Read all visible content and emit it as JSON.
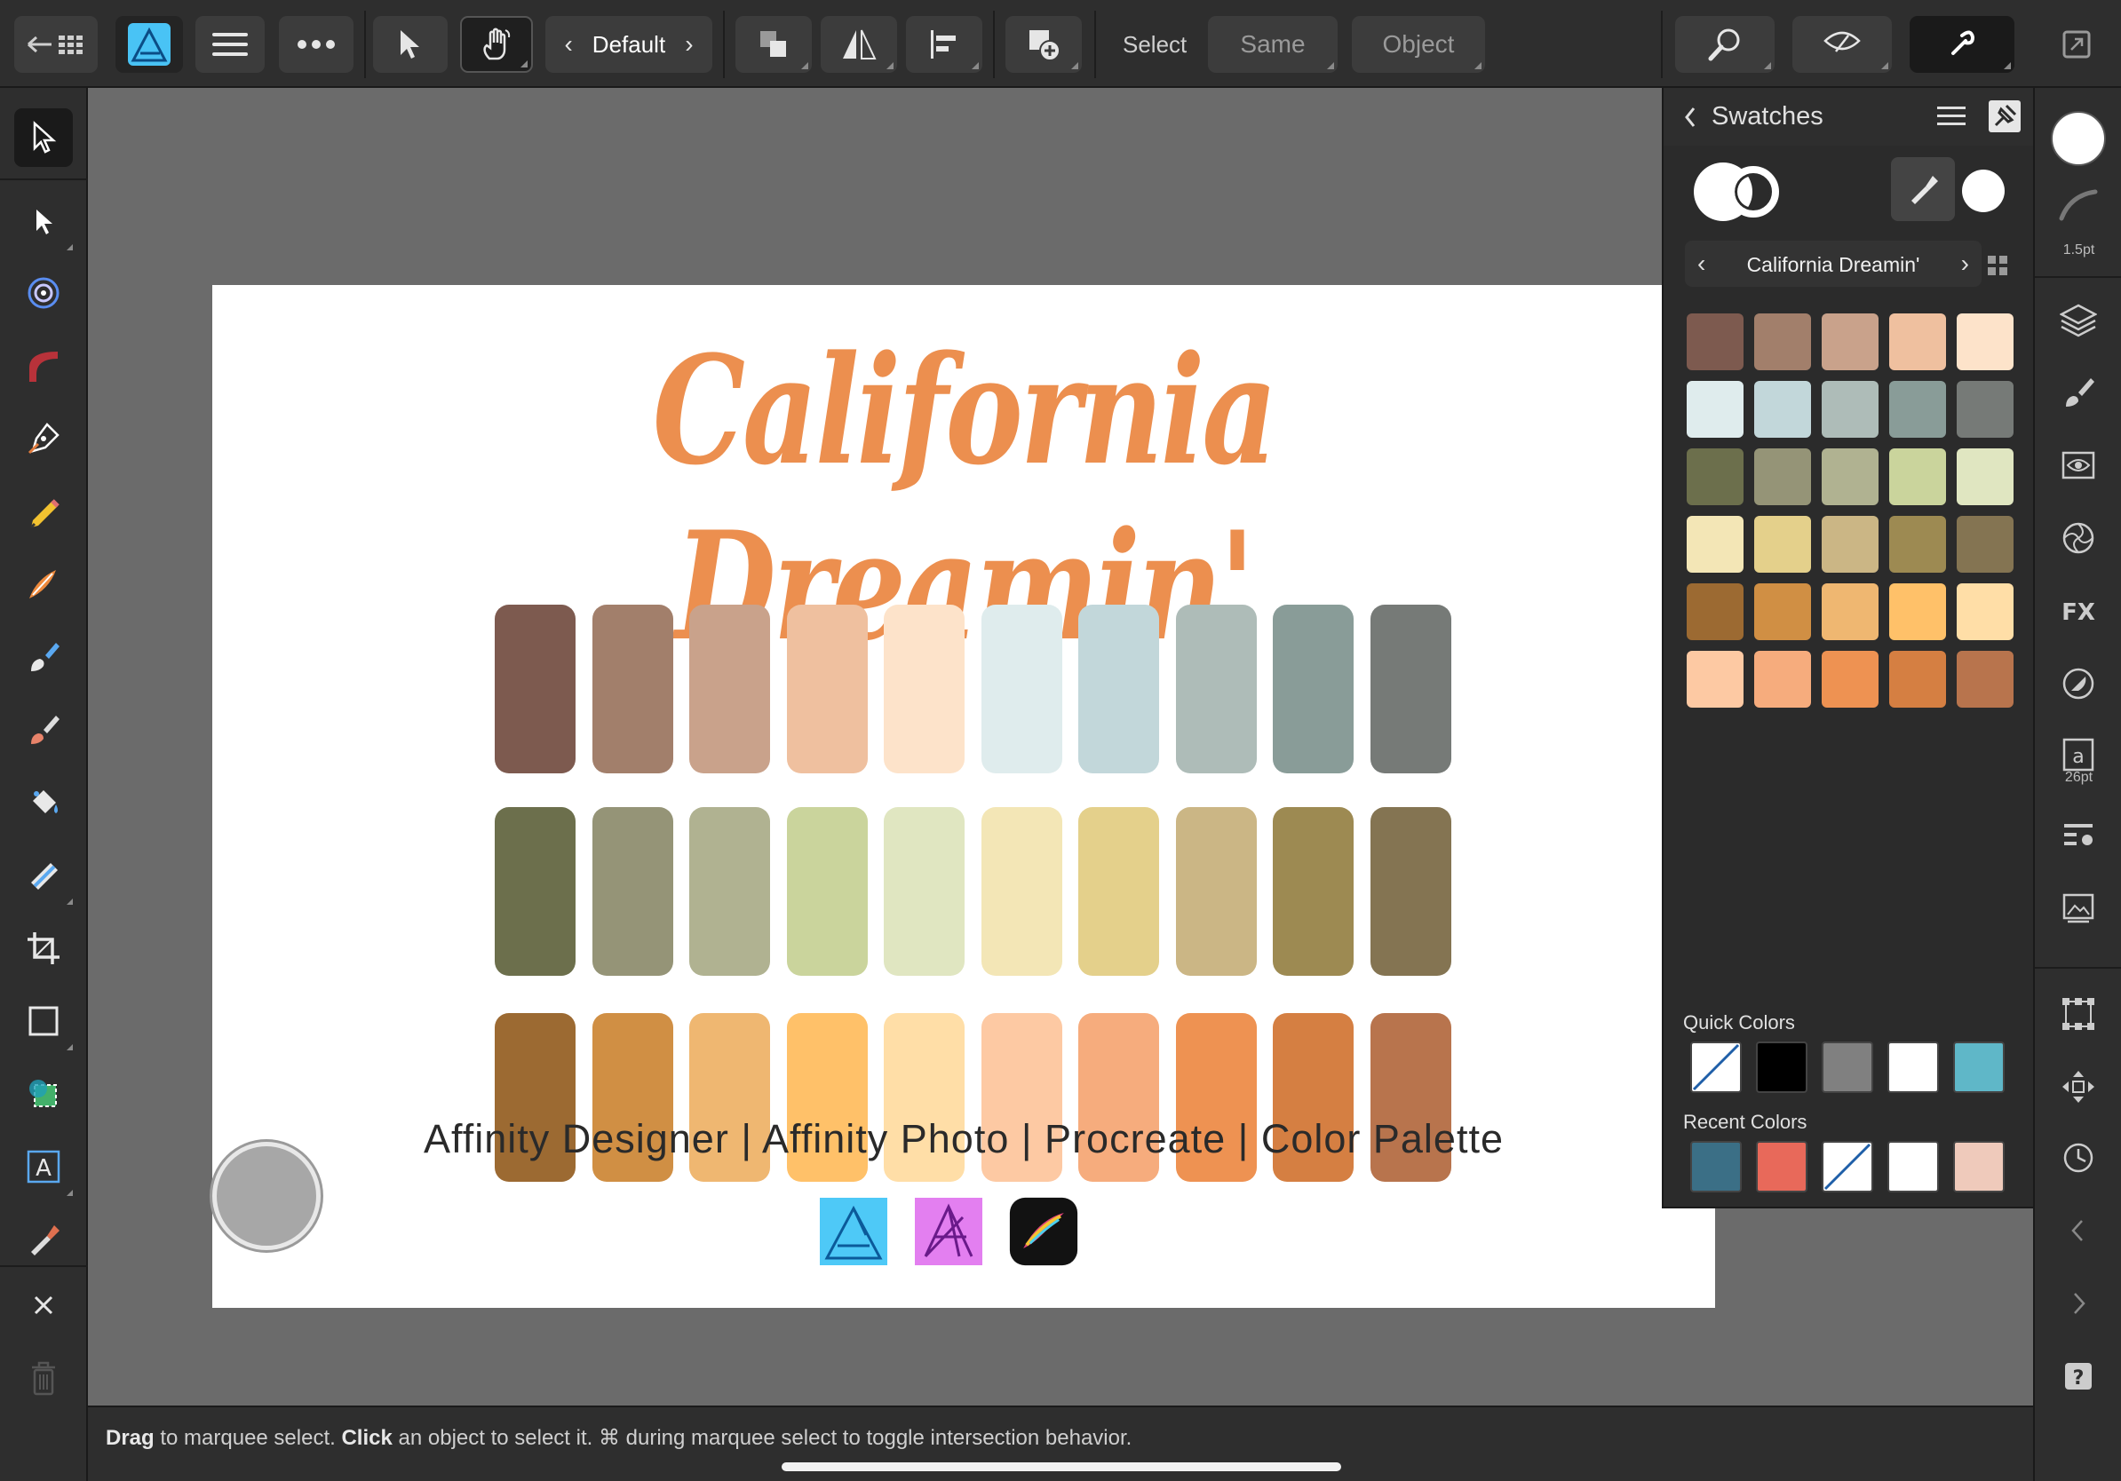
{
  "toolbar": {
    "view_mode": "Default",
    "select_label": "Select",
    "same_label": "Same",
    "object_label": "Object"
  },
  "artboard": {
    "title": "California Dreamin'",
    "subtitle": "Affinity Designer | Affinity Photo | Procreate | Color Palette",
    "palette_rows": [
      [
        "#7d5a4f",
        "#a27f6b",
        "#c9a28b",
        "#efc09f",
        "#fde3ca",
        "#dfeced",
        "#c2d7da",
        "#aebcb8",
        "#899c98",
        "#767a77"
      ],
      [
        "#6c6f4c",
        "#959477",
        "#b0b291",
        "#cad49c",
        "#e0e6c1",
        "#f3e6b6",
        "#e4d08b",
        "#cbb685",
        "#9d8a52",
        "#847452"
      ],
      [
        "#9c6a32",
        "#d08f44",
        "#efb771",
        "#ffc169",
        "#ffdea7",
        "#fdc9a3",
        "#f6ac7d",
        "#ee9252",
        "#d57f42",
        "#b8744d"
      ]
    ],
    "app_icons": [
      "affinity-designer-icon",
      "affinity-photo-icon",
      "procreate-icon"
    ]
  },
  "status": {
    "drag": "Drag",
    "drag_rest": " to marquee select. ",
    "click": "Click",
    "click_rest": " an object to select it. ⌘ during marquee select to toggle intersection behavior."
  },
  "swatches_panel": {
    "title": "Swatches",
    "palette_name": "California Dreamin'",
    "swatch_rows": [
      [
        "#7d5a4f",
        "#a27f6b",
        "#c9a28b",
        "#efc09f",
        "#fde3ca"
      ],
      [
        "#dfeced",
        "#c2d7da",
        "#aebcb8",
        "#899c98",
        "#767a77"
      ],
      [
        "#6c6f4c",
        "#959477",
        "#b0b291",
        "#cad49c",
        "#e0e6c1"
      ],
      [
        "#f3e6b6",
        "#e4d08b",
        "#cbb685",
        "#9d8a52",
        "#847452"
      ],
      [
        "#9c6a32",
        "#d08f44",
        "#efb771",
        "#ffc169",
        "#ffdea7"
      ],
      [
        "#fdc9a3",
        "#f6ac7d",
        "#ee9252",
        "#d57f42",
        "#b8744d"
      ]
    ],
    "quick_colors_label": "Quick Colors",
    "quick_colors": [
      "none",
      "#000000",
      "#808080",
      "#ffffff",
      "#5fb7c8"
    ],
    "recent_colors_label": "Recent Colors",
    "recent_colors": [
      "#3b6f86",
      "#e8695a",
      "none",
      "#ffffff",
      "#efcabb"
    ]
  },
  "right_strip": {
    "stroke_width": "1.5pt",
    "font_size": "26pt"
  }
}
